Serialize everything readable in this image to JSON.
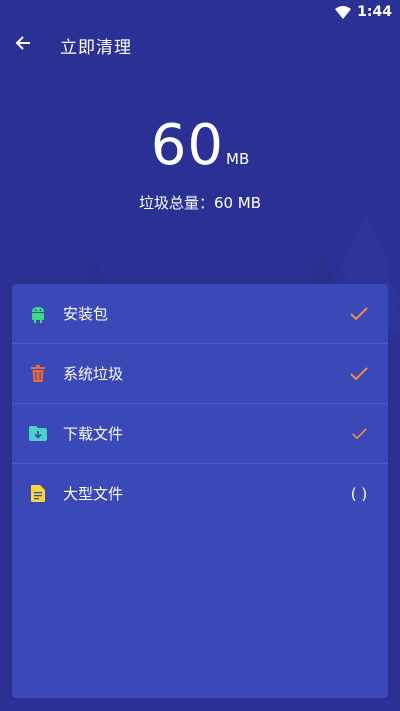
{
  "status_bar": {
    "time": "1:44",
    "wifi_icon": "wifi-icon"
  },
  "app_bar": {
    "back_icon": "arrow-back-icon",
    "title": "立即清理"
  },
  "summary": {
    "size_value": "60",
    "size_unit": "MB",
    "total_label": "垃圾总量：60 MB"
  },
  "items": [
    {
      "label": "安装包",
      "icon": "android-icon",
      "icon_color": "#3ddc84",
      "checked": true,
      "status": ""
    },
    {
      "label": "系统垃圾",
      "icon": "trash-icon",
      "icon_color": "#ef6c2f",
      "checked": true,
      "status": ""
    },
    {
      "label": "下载文件",
      "icon": "download-folder-icon",
      "icon_color": "#4dd0c6",
      "checked": true,
      "status": ""
    },
    {
      "label": "大型文件",
      "icon": "document-icon",
      "icon_color": "#f7d43a",
      "checked": false,
      "status": "( )"
    }
  ],
  "colors": {
    "background": "#2a3094",
    "card": "#3a48b8",
    "check": "#f08a4b"
  }
}
